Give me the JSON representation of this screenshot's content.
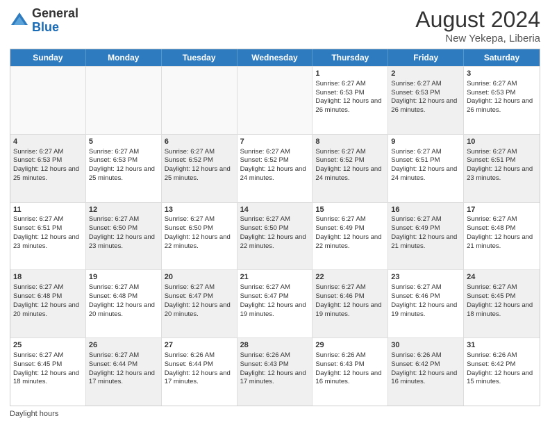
{
  "header": {
    "logo_general": "General",
    "logo_blue": "Blue",
    "month_year": "August 2024",
    "location": "New Yekepa, Liberia"
  },
  "days_of_week": [
    "Sunday",
    "Monday",
    "Tuesday",
    "Wednesday",
    "Thursday",
    "Friday",
    "Saturday"
  ],
  "footer_label": "Daylight hours",
  "rows": [
    [
      {
        "day": "",
        "sunrise": "",
        "sunset": "",
        "daylight": "",
        "shaded": false,
        "empty": true
      },
      {
        "day": "",
        "sunrise": "",
        "sunset": "",
        "daylight": "",
        "shaded": false,
        "empty": true
      },
      {
        "day": "",
        "sunrise": "",
        "sunset": "",
        "daylight": "",
        "shaded": false,
        "empty": true
      },
      {
        "day": "",
        "sunrise": "",
        "sunset": "",
        "daylight": "",
        "shaded": false,
        "empty": true
      },
      {
        "day": "1",
        "sunrise": "6:27 AM",
        "sunset": "6:53 PM",
        "daylight": "12 hours and 26 minutes.",
        "shaded": false,
        "empty": false
      },
      {
        "day": "2",
        "sunrise": "6:27 AM",
        "sunset": "6:53 PM",
        "daylight": "12 hours and 26 minutes.",
        "shaded": true,
        "empty": false
      },
      {
        "day": "3",
        "sunrise": "6:27 AM",
        "sunset": "6:53 PM",
        "daylight": "12 hours and 26 minutes.",
        "shaded": false,
        "empty": false
      }
    ],
    [
      {
        "day": "4",
        "sunrise": "6:27 AM",
        "sunset": "6:53 PM",
        "daylight": "12 hours and 25 minutes.",
        "shaded": true,
        "empty": false
      },
      {
        "day": "5",
        "sunrise": "6:27 AM",
        "sunset": "6:53 PM",
        "daylight": "12 hours and 25 minutes.",
        "shaded": false,
        "empty": false
      },
      {
        "day": "6",
        "sunrise": "6:27 AM",
        "sunset": "6:52 PM",
        "daylight": "12 hours and 25 minutes.",
        "shaded": true,
        "empty": false
      },
      {
        "day": "7",
        "sunrise": "6:27 AM",
        "sunset": "6:52 PM",
        "daylight": "12 hours and 24 minutes.",
        "shaded": false,
        "empty": false
      },
      {
        "day": "8",
        "sunrise": "6:27 AM",
        "sunset": "6:52 PM",
        "daylight": "12 hours and 24 minutes.",
        "shaded": true,
        "empty": false
      },
      {
        "day": "9",
        "sunrise": "6:27 AM",
        "sunset": "6:51 PM",
        "daylight": "12 hours and 24 minutes.",
        "shaded": false,
        "empty": false
      },
      {
        "day": "10",
        "sunrise": "6:27 AM",
        "sunset": "6:51 PM",
        "daylight": "12 hours and 23 minutes.",
        "shaded": true,
        "empty": false
      }
    ],
    [
      {
        "day": "11",
        "sunrise": "6:27 AM",
        "sunset": "6:51 PM",
        "daylight": "12 hours and 23 minutes.",
        "shaded": false,
        "empty": false
      },
      {
        "day": "12",
        "sunrise": "6:27 AM",
        "sunset": "6:50 PM",
        "daylight": "12 hours and 23 minutes.",
        "shaded": true,
        "empty": false
      },
      {
        "day": "13",
        "sunrise": "6:27 AM",
        "sunset": "6:50 PM",
        "daylight": "12 hours and 22 minutes.",
        "shaded": false,
        "empty": false
      },
      {
        "day": "14",
        "sunrise": "6:27 AM",
        "sunset": "6:50 PM",
        "daylight": "12 hours and 22 minutes.",
        "shaded": true,
        "empty": false
      },
      {
        "day": "15",
        "sunrise": "6:27 AM",
        "sunset": "6:49 PM",
        "daylight": "12 hours and 22 minutes.",
        "shaded": false,
        "empty": false
      },
      {
        "day": "16",
        "sunrise": "6:27 AM",
        "sunset": "6:49 PM",
        "daylight": "12 hours and 21 minutes.",
        "shaded": true,
        "empty": false
      },
      {
        "day": "17",
        "sunrise": "6:27 AM",
        "sunset": "6:48 PM",
        "daylight": "12 hours and 21 minutes.",
        "shaded": false,
        "empty": false
      }
    ],
    [
      {
        "day": "18",
        "sunrise": "6:27 AM",
        "sunset": "6:48 PM",
        "daylight": "12 hours and 20 minutes.",
        "shaded": true,
        "empty": false
      },
      {
        "day": "19",
        "sunrise": "6:27 AM",
        "sunset": "6:48 PM",
        "daylight": "12 hours and 20 minutes.",
        "shaded": false,
        "empty": false
      },
      {
        "day": "20",
        "sunrise": "6:27 AM",
        "sunset": "6:47 PM",
        "daylight": "12 hours and 20 minutes.",
        "shaded": true,
        "empty": false
      },
      {
        "day": "21",
        "sunrise": "6:27 AM",
        "sunset": "6:47 PM",
        "daylight": "12 hours and 19 minutes.",
        "shaded": false,
        "empty": false
      },
      {
        "day": "22",
        "sunrise": "6:27 AM",
        "sunset": "6:46 PM",
        "daylight": "12 hours and 19 minutes.",
        "shaded": true,
        "empty": false
      },
      {
        "day": "23",
        "sunrise": "6:27 AM",
        "sunset": "6:46 PM",
        "daylight": "12 hours and 19 minutes.",
        "shaded": false,
        "empty": false
      },
      {
        "day": "24",
        "sunrise": "6:27 AM",
        "sunset": "6:45 PM",
        "daylight": "12 hours and 18 minutes.",
        "shaded": true,
        "empty": false
      }
    ],
    [
      {
        "day": "25",
        "sunrise": "6:27 AM",
        "sunset": "6:45 PM",
        "daylight": "12 hours and 18 minutes.",
        "shaded": false,
        "empty": false
      },
      {
        "day": "26",
        "sunrise": "6:27 AM",
        "sunset": "6:44 PM",
        "daylight": "12 hours and 17 minutes.",
        "shaded": true,
        "empty": false
      },
      {
        "day": "27",
        "sunrise": "6:26 AM",
        "sunset": "6:44 PM",
        "daylight": "12 hours and 17 minutes.",
        "shaded": false,
        "empty": false
      },
      {
        "day": "28",
        "sunrise": "6:26 AM",
        "sunset": "6:43 PM",
        "daylight": "12 hours and 17 minutes.",
        "shaded": true,
        "empty": false
      },
      {
        "day": "29",
        "sunrise": "6:26 AM",
        "sunset": "6:43 PM",
        "daylight": "12 hours and 16 minutes.",
        "shaded": false,
        "empty": false
      },
      {
        "day": "30",
        "sunrise": "6:26 AM",
        "sunset": "6:42 PM",
        "daylight": "12 hours and 16 minutes.",
        "shaded": true,
        "empty": false
      },
      {
        "day": "31",
        "sunrise": "6:26 AM",
        "sunset": "6:42 PM",
        "daylight": "12 hours and 15 minutes.",
        "shaded": false,
        "empty": false
      }
    ]
  ]
}
